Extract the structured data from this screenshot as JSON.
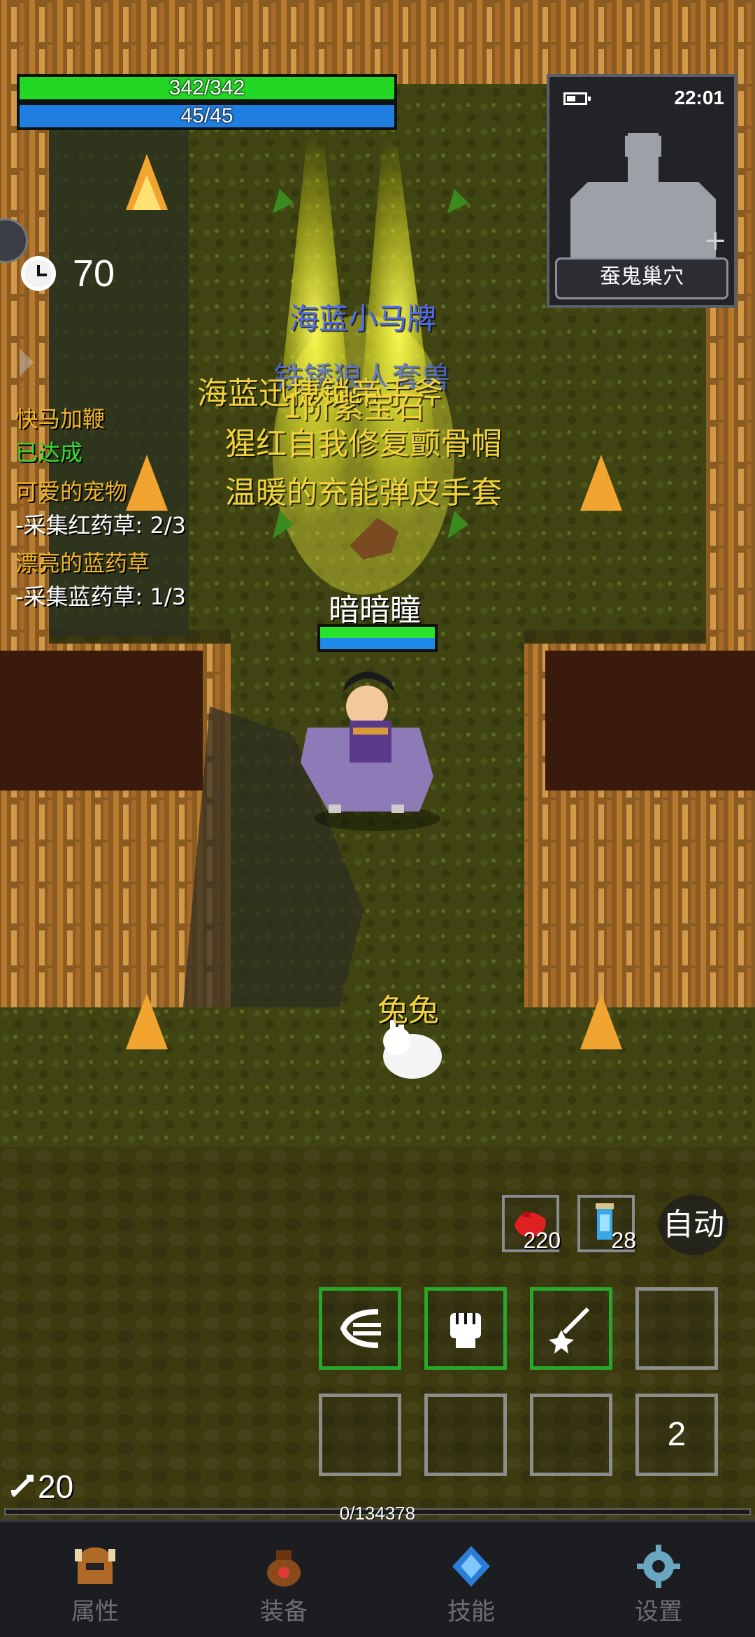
{
  "player": {
    "hp": "342/342",
    "mp": "45/45",
    "name": "暗暗瞳",
    "attack": "20"
  },
  "minimap": {
    "time": "22:01",
    "location": "蚕鬼巢穴"
  },
  "timer": {
    "value": "70"
  },
  "quests": [
    {
      "title": "快马加鞭",
      "status": "已达成"
    },
    {
      "title": "可爱的宠物",
      "progress": "-采集红药草: 2/3"
    },
    {
      "title": "漂亮的蓝药草",
      "progress": "-采集蓝药草: 1/3"
    }
  ],
  "loot_labels": {
    "blue": [
      "海蓝小马牌",
      "铁锈狼人套兽"
    ],
    "yellow": [
      "海蓝迅捷锁帝手斧",
      "1阶紫宝石",
      "猩红自我修复颤骨帽",
      "温暖的充能弹皮手套"
    ]
  },
  "pet": {
    "name": "兔兔"
  },
  "potions": {
    "red_count": "220",
    "blue_count": "28"
  },
  "auto_label": "自动",
  "skill_page": "2",
  "experience": {
    "text": "0/134378",
    "fraction": 0
  },
  "nav": {
    "attributes": "属性",
    "equipment": "装备",
    "skills": "技能",
    "settings": "设置"
  },
  "colors": {
    "hp": "#22d824",
    "mp": "#1f7ee0",
    "quest_title": "#f0b428",
    "quest_done": "#33dd33",
    "loot_blue": "#4f6cf0",
    "loot_yellow": "#f2d23c",
    "skill_active_border": "#27a82a"
  }
}
